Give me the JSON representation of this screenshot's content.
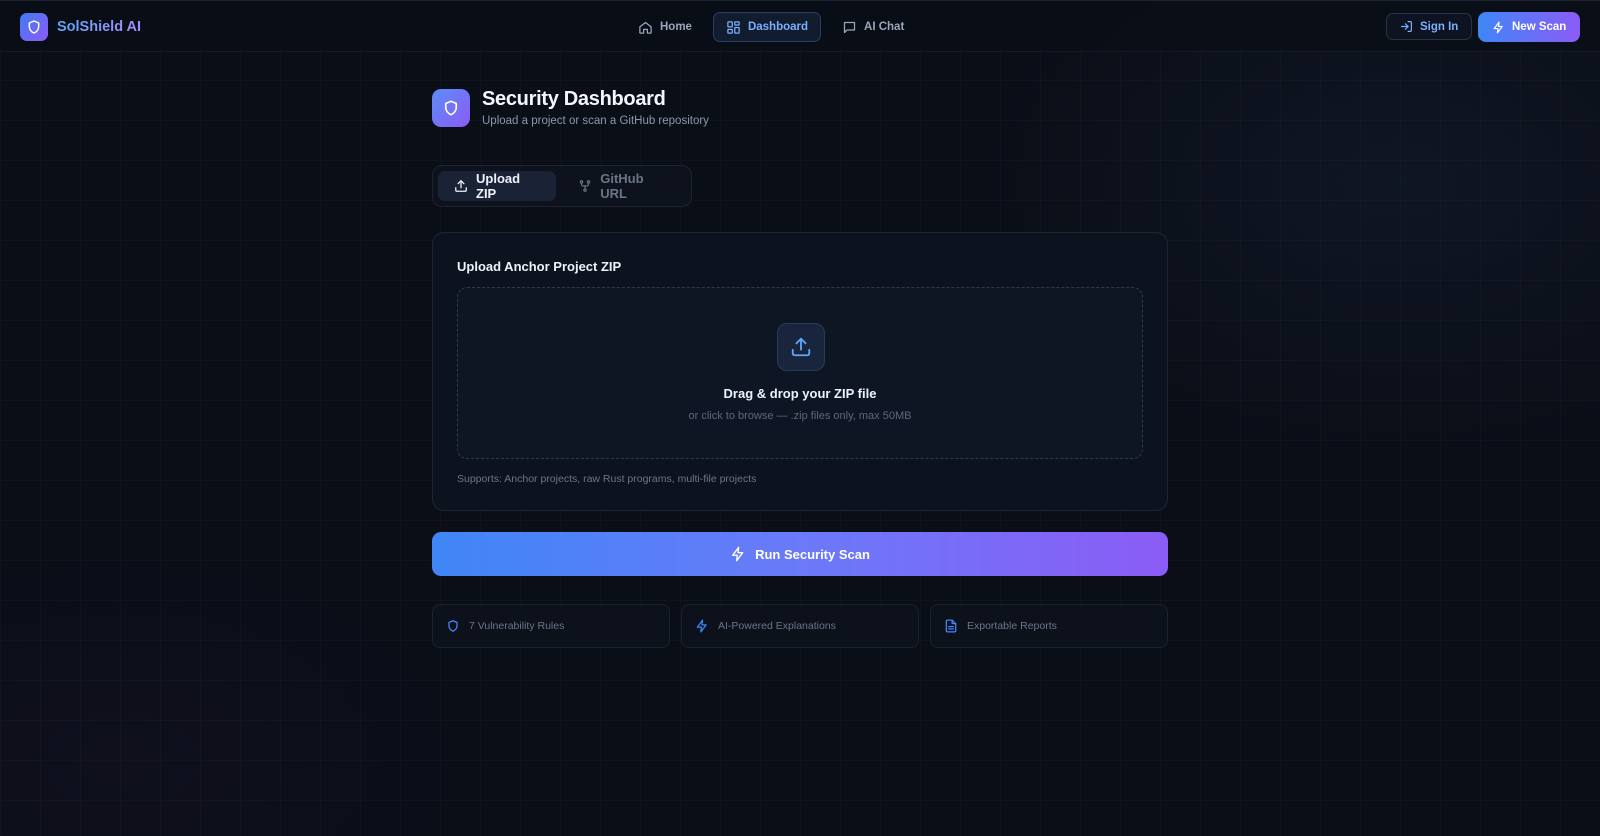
{
  "brand": {
    "name": "SolShield AI",
    "logo_icon": "shield-icon"
  },
  "nav": {
    "items": [
      {
        "label": "Home",
        "icon": "home-icon",
        "active": false
      },
      {
        "label": "Dashboard",
        "icon": "grid-icon",
        "active": true
      },
      {
        "label": "AI Chat",
        "icon": "chat-icon",
        "active": false
      }
    ],
    "sign_in_label": "Sign In",
    "new_scan_label": "New Scan"
  },
  "header": {
    "title": "Security Dashboard",
    "subtitle": "Upload a project or scan a GitHub repository",
    "icon": "shield-icon"
  },
  "tabs": [
    {
      "label": "Upload ZIP",
      "icon": "upload-icon",
      "active": true
    },
    {
      "label": "GitHub URL",
      "icon": "git-branch-icon",
      "active": false
    }
  ],
  "upload": {
    "title": "Upload Anchor Project ZIP",
    "dropzone_title": "Drag & drop your ZIP file",
    "dropzone_subtitle": "or click to browse — .zip files only, max 50MB",
    "supports_text": "Supports: Anchor projects, raw Rust programs, multi-file projects"
  },
  "run_button_label": "Run Security Scan",
  "features": [
    {
      "label": "7 Vulnerability Rules",
      "icon": "shield-icon"
    },
    {
      "label": "AI-Powered Explanations",
      "icon": "zap-icon"
    },
    {
      "label": "Exportable Reports",
      "icon": "file-text-icon"
    }
  ],
  "colors": {
    "background": "#0a0e17",
    "accent_blue": "#3f86f7",
    "accent_purple": "#8b5cf6",
    "nav_active_text": "#7ab0ff"
  }
}
